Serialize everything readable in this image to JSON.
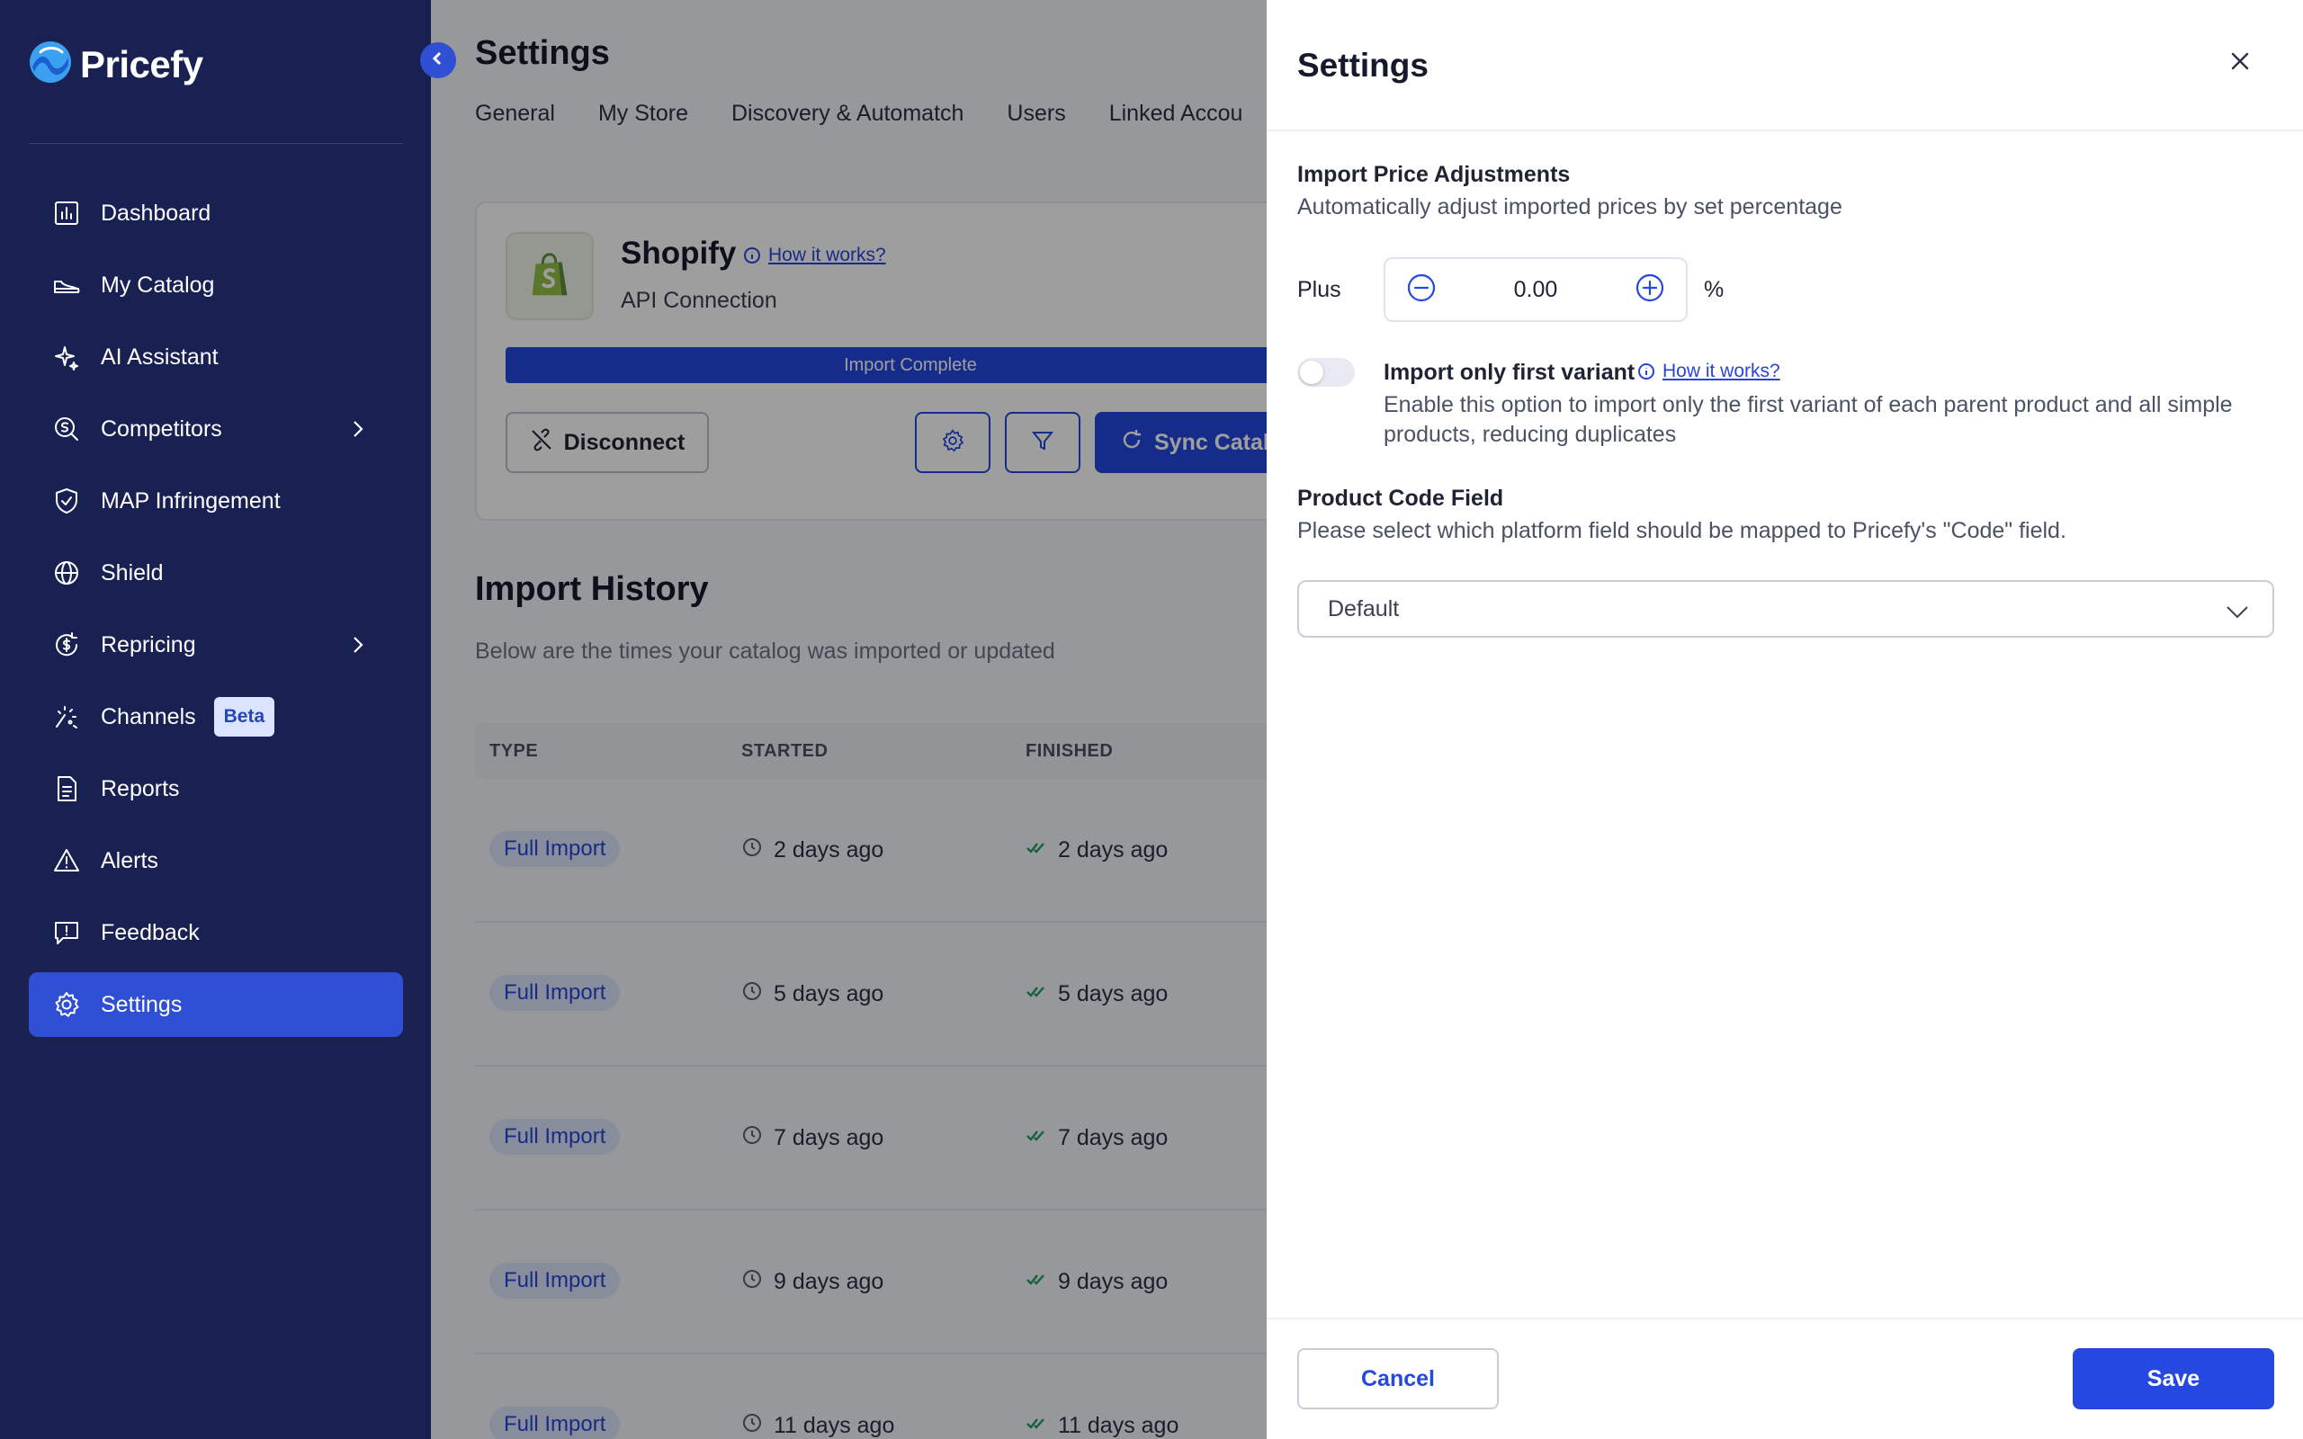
{
  "app": {
    "name": "Pricefy"
  },
  "sidebar": {
    "items": [
      {
        "label": "Dashboard",
        "icon": "chart-icon"
      },
      {
        "label": "My Catalog",
        "icon": "shoe-icon"
      },
      {
        "label": "AI Assistant",
        "icon": "sparkle-icon"
      },
      {
        "label": "Competitors",
        "icon": "search-dollar-icon",
        "has_children": true
      },
      {
        "label": "MAP Infringement",
        "icon": "shield-check-icon"
      },
      {
        "label": "Shield",
        "icon": "globe-icon"
      },
      {
        "label": "Repricing",
        "icon": "dollar-cycle-icon",
        "has_children": true
      },
      {
        "label": "Channels",
        "icon": "fireworks-icon",
        "badge": "Beta"
      },
      {
        "label": "Reports",
        "icon": "document-icon"
      },
      {
        "label": "Alerts",
        "icon": "warning-icon"
      },
      {
        "label": "Feedback",
        "icon": "feedback-icon"
      },
      {
        "label": "Settings",
        "icon": "gear-icon",
        "active": true
      }
    ]
  },
  "main": {
    "title": "Settings",
    "tabs": [
      "General",
      "My Store",
      "Discovery & Automatch",
      "Users",
      "Linked Accou"
    ],
    "integration": {
      "name": "Shopify",
      "how_it_works": "How it works?",
      "subtitle": "API Connection",
      "progress_label": "Import Complete",
      "progress_percent": 100,
      "disconnect_label": "Disconnect",
      "sync_label": "Sync Catal"
    },
    "history": {
      "title": "Import History",
      "subtitle": "Below are the times your catalog was imported or updated",
      "columns": [
        "TYPE",
        "STARTED",
        "FINISHED"
      ],
      "rows": [
        {
          "type": "Full Import",
          "started": "2 days ago",
          "finished": "2 days ago"
        },
        {
          "type": "Full Import",
          "started": "5 days ago",
          "finished": "5 days ago"
        },
        {
          "type": "Full Import",
          "started": "7 days ago",
          "finished": "7 days ago"
        },
        {
          "type": "Full Import",
          "started": "9 days ago",
          "finished": "9 days ago"
        },
        {
          "type": "Full Import",
          "started": "11 days ago",
          "finished": "11 days ago"
        }
      ]
    }
  },
  "drawer": {
    "title": "Settings",
    "price_adjust": {
      "label": "Import Price Adjustments",
      "description": "Automatically adjust imported prices by set percentage",
      "prefix": "Plus",
      "value": "0.00",
      "unit": "%"
    },
    "first_variant": {
      "label": "Import only first variant",
      "how_it_works": "How it works?",
      "description": "Enable this option to import only the first variant of each parent product and all simple products, reducing duplicates",
      "enabled": false
    },
    "product_code": {
      "label": "Product Code Field",
      "description": "Please select which platform field should be mapped to Pricefy's \"Code\" field.",
      "selected": "Default"
    },
    "cancel_label": "Cancel",
    "save_label": "Save"
  },
  "colors": {
    "sidebar": "#192152",
    "accent": "#2548e0",
    "active_nav": "#2f4fd4",
    "success": "#1f9d63"
  }
}
